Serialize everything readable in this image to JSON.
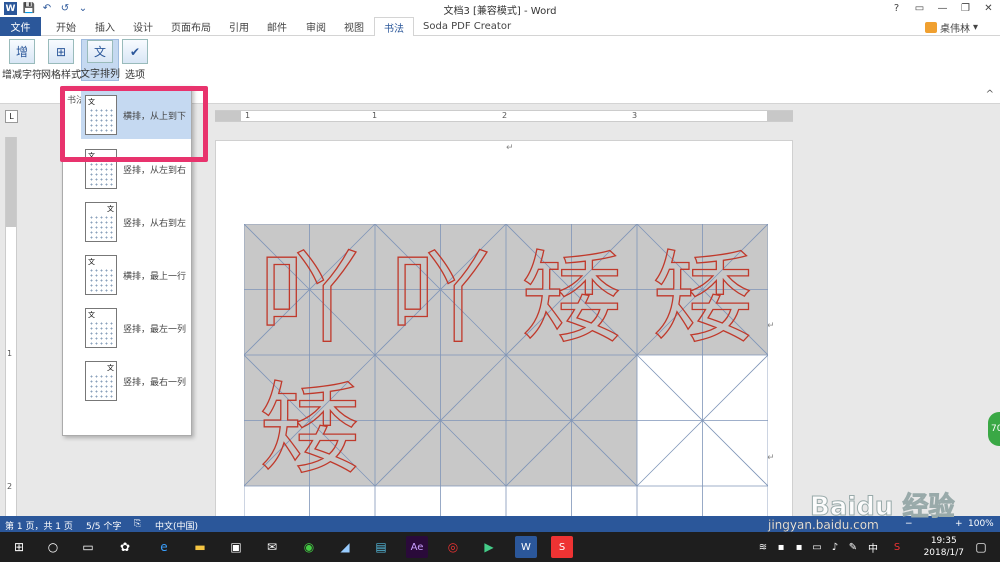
{
  "window": {
    "title": "文档3 [兼容模式] - Word",
    "controls": [
      "?",
      "▭",
      "—",
      "❐",
      "✕"
    ]
  },
  "qat": {
    "save": "💾",
    "undo": "↶",
    "redo": "↺",
    "more": "⌄"
  },
  "tabs": [
    "文件",
    "开始",
    "插入",
    "设计",
    "页面布局",
    "引用",
    "邮件",
    "审阅",
    "视图",
    "书法",
    "Soda PDF Creator"
  ],
  "user": {
    "name": "桌伟林"
  },
  "ribbon": {
    "buttons": [
      {
        "label": "增减字符",
        "icon": "增"
      },
      {
        "label": "网格样式",
        "icon": "⊞"
      },
      {
        "label": "文字排列",
        "icon": "文"
      },
      {
        "label": "选项",
        "icon": "✔"
      }
    ],
    "collapse": "^"
  },
  "ruler": {
    "numbers": [
      "1",
      "1",
      "2",
      "3"
    ],
    "vnumbers": [
      "1",
      "2"
    ],
    "corner": "L"
  },
  "gallery": {
    "header": "书法",
    "items": [
      {
        "label": "横排，从上到下",
        "glyph": "文"
      },
      {
        "label": "竖排，从左到右",
        "glyph": "文"
      },
      {
        "label": "竖排，从右到左",
        "glyph": "文"
      },
      {
        "label": "横排，最上一行",
        "glyph": "文"
      },
      {
        "label": "竖排，最左一列",
        "glyph": "文"
      },
      {
        "label": "竖排，最右一列",
        "glyph": "文"
      }
    ]
  },
  "document": {
    "chars": [
      "吖",
      "吖",
      "矮",
      "矮",
      "矮"
    ],
    "para_mark": "↵"
  },
  "status": {
    "page": "第 1 页，共 1 页",
    "words": "5/5 个字",
    "lang": "中文(中国)",
    "zoom": "100%"
  },
  "taskbar": {
    "time": "19:35",
    "date": "2018/1/7",
    "ime": "中"
  },
  "watermark": {
    "logo": "Baidu 经验",
    "url": "jingyan.baidu.com"
  },
  "side_badge": "70"
}
